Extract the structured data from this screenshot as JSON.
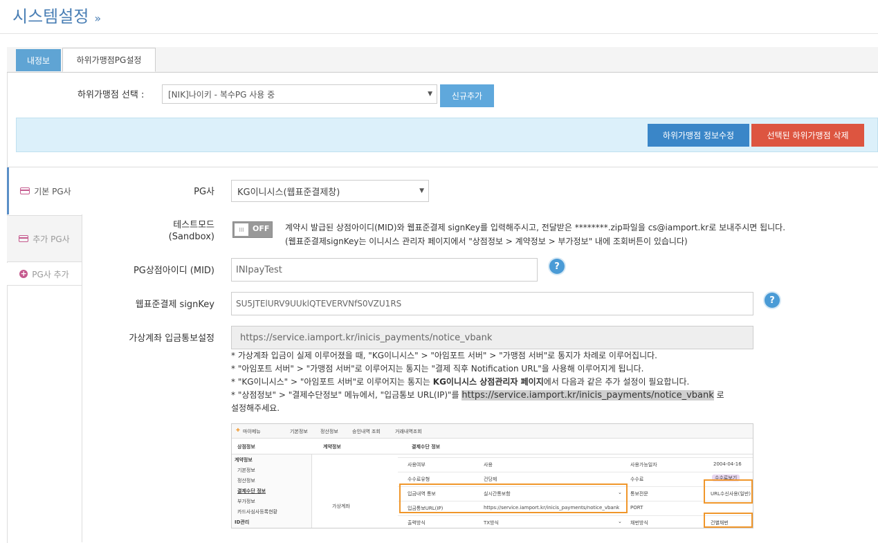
{
  "header": {
    "title": "시스템설정",
    "chevron": "»"
  },
  "tabs": [
    {
      "label": "내정보",
      "active": false
    },
    {
      "label": "하위가맹점PG설정",
      "active": true
    }
  ],
  "merchant": {
    "label": "하위가맹점 선택 :",
    "selected": "[NIK]나이키 - 복수PG 사용 중",
    "new_button": "신규추가"
  },
  "actions": {
    "edit": "하위가맹점 정보수정",
    "delete": "선택된 하위가맹점 삭제"
  },
  "sidebar": {
    "items": [
      {
        "label": "기본 PG사",
        "icon": "card-icon",
        "active": true
      },
      {
        "label": "추가 PG사",
        "icon": "card-icon",
        "active": false
      },
      {
        "label": "PG사 추가",
        "icon": "plus-circle-icon",
        "active": false
      }
    ]
  },
  "form": {
    "pg": {
      "label": "PG사",
      "value": "KG이니시스(웹표준결제창)"
    },
    "test_mode": {
      "label_line1": "테스트모드",
      "label_line2": "(Sandbox)",
      "toggle_off_text": "OFF",
      "toggle_knob": "III",
      "desc_line1": "계약시 발급된 상점아이디(MID)와 웹표준결제 signKey를 입력해주시고, 전달받은 ********.zip파일을 cs@iamport.kr로 보내주시면 됩니다.",
      "desc_line2": "(웹표준결제signKey는 이니시스 관리자 페이지에서 \"상점정보 > 계약정보 > 부가정보\" 내에 조회버튼이 있습니다)"
    },
    "mid": {
      "label": "PG상점아이디 (MID)",
      "value": "INIpayTest",
      "help": "?"
    },
    "signkey": {
      "label": "웹표준결제 signKey",
      "value": "SU5JTElURV9UUklQTEVERVNfS0VZU1RS",
      "help": "?"
    },
    "vbank": {
      "label": "가상계좌 입금통보설정",
      "value": "https://service.iamport.kr/inicis_payments/notice_vbank"
    },
    "notes": {
      "n1": "* 가상계좌 입금이 실제 이루어졌을 때, \"KG이니시스\" > \"아임포트 서버\" > \"가맹점 서버\"로 통지가 차례로 이루어집니다.",
      "n2": "* \"아임포트 서버\" > \"가맹점 서버\"로 이루어지는 통지는 \"결제 직후 Notification URL\"을 사용해 이루어지게 됩니다.",
      "n3_pre": "* \"KG이니시스\" > \"아임포트 서버\"로 이루어지는 통지는 ",
      "n3_bold": "KG이니시스 상점관리자 페이지",
      "n3_post": "에서 다음과 같은 추가 설정이 필요합니다.",
      "n4_pre": "* \"상점정보\" > \"결제수단정보\" 메뉴에서, \"입금통보 URL(IP)\"를 ",
      "n4_url": "https://service.iamport.kr/inicis_payments/notice_vbank",
      "n4_post": " 로",
      "n5": "설정해주세요."
    }
  },
  "screenshot": {
    "menu": [
      "마이메뉴",
      "기본정보",
      "정산정보",
      "승인내역 조회",
      "거래내역조회"
    ],
    "tabs": [
      "상점정보",
      "계약정보",
      "결제수단 정보"
    ],
    "side": [
      "계약정보",
      "기본정보",
      "정산정보",
      "결제수단 정보",
      "부가정보",
      "카드사심사등록현황",
      "ID관리"
    ],
    "section": "가상계좌",
    "rows": [
      {
        "k1": "사용여부",
        "v1": "사용",
        "k2": "사용가능일자",
        "v2": "2004-04-16"
      },
      {
        "k1": "수수료유형",
        "v1": "건당제",
        "k2": "수수료",
        "v2": "수수료보기"
      },
      {
        "k1": "입금내역 통보",
        "v1": "실시간통보함",
        "k2": "통보전문",
        "v2": "URL수신사용(일반)"
      },
      {
        "k1": "입금통보URL(IP)",
        "v1": "https://service.iamport.kr/inicis_payments/notice_vbank",
        "k2": "PORT",
        "v2": ""
      },
      {
        "k1": "출력방식",
        "v1": "TX방식",
        "k2": "채번방식",
        "v2": "건별채번"
      }
    ]
  }
}
